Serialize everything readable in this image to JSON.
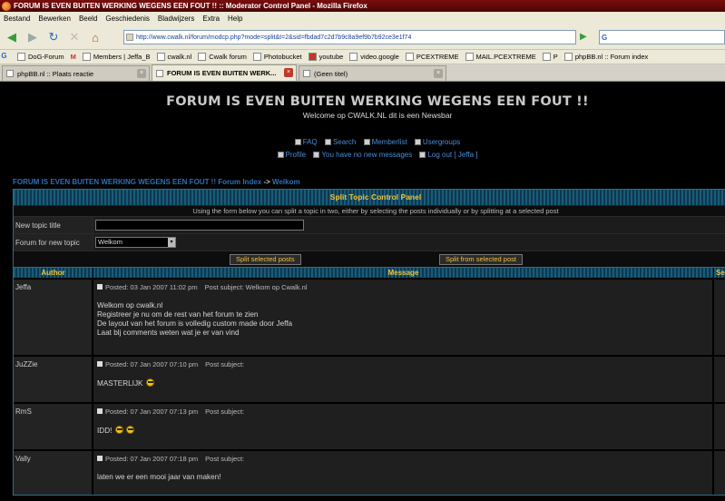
{
  "window": {
    "title": "FORUM IS EVEN BUITEN WERKING WEGENS EEN FOUT !! :: Moderator Control Panel - Mozilla Firefox"
  },
  "menu": [
    "Bestand",
    "Bewerken",
    "Beeld",
    "Geschiedenis",
    "Bladwijzers",
    "Extra",
    "Help"
  ],
  "url": "http://www.cwalk.nl/forum/modcp.php?mode=split&t=2&sid=fbdad7c2d7b9c8a9ef9b7b92ce3e1f74",
  "search": {
    "engine_letter": "G"
  },
  "bookmarks": [
    "DoG-Forum",
    "Members | Jeffa_B",
    "cwalk.nl",
    "Cwalk forum",
    "Photobucket",
    "youtube",
    "video.google",
    "PCEXTREME",
    "MAIL.PCEXTREME",
    "P",
    "phpBB.nl :: Forum index"
  ],
  "tabs": [
    {
      "label": "phpBB.nl :: Plaats reactie"
    },
    {
      "label": "FORUM IS EVEN BUITEN WERK..."
    },
    {
      "label": "(Geen titel)"
    }
  ],
  "site": {
    "title": "FORUM IS EVEN BUITEN WERKING WEGENS EEN FOUT !!",
    "description": "Welcome op CWALK.NL dit is een Newsbar",
    "nav_row1": [
      "FAQ",
      "Search",
      "Memberlist",
      "Usergroups"
    ],
    "nav_row2": [
      "Profile",
      "You have no new messages",
      "Log out [ Jeffa ]"
    ]
  },
  "breadcrumb": {
    "forum_index": "FORUM IS EVEN BUITEN WERKING WEGENS EEN FOUT !! Forum Index",
    "separator": "->",
    "topic": "Welkom"
  },
  "panel": {
    "title": "Split Topic Control Panel",
    "info": "Using the form below you can split a topic in two, either by selecting the posts individually or by splitting at a selected post",
    "new_title_label": "New topic title",
    "new_title_value": "",
    "forum_label": "Forum for new topic",
    "forum_value": "Welkom",
    "split_selected": "Split selected posts",
    "split_from": "Split from selected post",
    "col_author": "Author",
    "col_message": "Message",
    "col_select": "Se"
  },
  "posts": [
    {
      "author": "Jeffa",
      "posted": "Posted: 03 Jan 2007 11:02 pm",
      "subject": "Post subject: Welkom op Cwalk.nl",
      "lines": [
        "Welkom op cwalk.nl",
        "Registreer je nu om de rest van het forum te zien",
        "De layout van het forum is volledig custom made door Jeffa",
        "Laat blj comments weten wat je er van vind"
      ]
    },
    {
      "author": "JuZZie",
      "posted": "Posted: 07 Jan 2007 07:10 pm",
      "subject": "Post subject:",
      "lines": [
        "MASTERLIJK"
      ]
    },
    {
      "author": "RmS",
      "posted": "Posted: 07 Jan 2007 07:13 pm",
      "subject": "Post subject:",
      "lines": [
        "IDD!"
      ]
    },
    {
      "author": "Vally",
      "posted": "Posted: 07 Jan 2007 07:18 pm",
      "subject": "Post subject:",
      "lines": [
        "laten we er een mooi jaar van maken!"
      ]
    }
  ],
  "colors": {
    "accent": "#f0c23a",
    "link": "#4a8ed6",
    "header_bar": "#1a5c78"
  }
}
